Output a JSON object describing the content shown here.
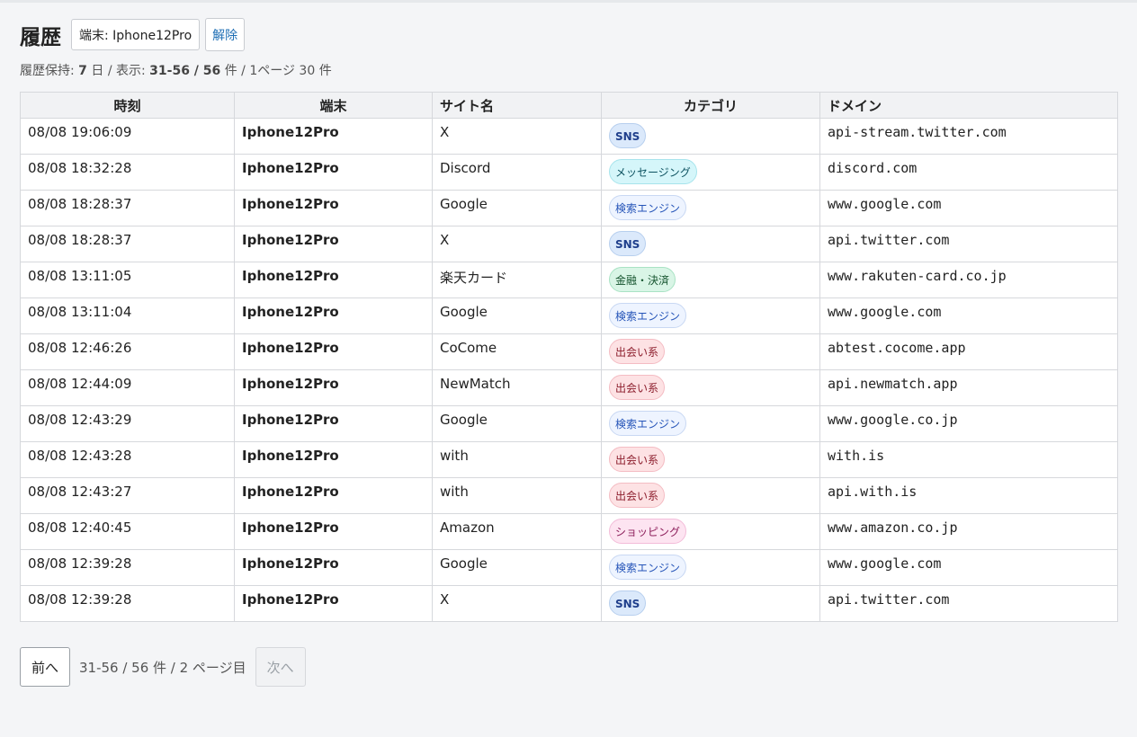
{
  "header": {
    "title": "履歴",
    "filter_label": "端末: Iphone12Pro",
    "clear_label": "解除"
  },
  "summary": {
    "retention_label": "履歴保持: ",
    "retention_value": "7",
    "retention_unit": " 日 / 表示: ",
    "range": "31-56 / 56",
    "range_unit": " 件",
    "per_page": " / 1ページ 30 件"
  },
  "table": {
    "columns": [
      "時刻",
      "端末",
      "サイト名",
      "カテゴリ",
      "ドメイン"
    ],
    "rows": [
      {
        "time": "08/08 19:06:09",
        "device": "Iphone12Pro",
        "site": "X",
        "category": "SNS",
        "category_type": "sns",
        "domain": "api-stream.twitter.com"
      },
      {
        "time": "08/08 18:32:28",
        "device": "Iphone12Pro",
        "site": "Discord",
        "category": "メッセージング",
        "category_type": "msg",
        "domain": "discord.com"
      },
      {
        "time": "08/08 18:28:37",
        "device": "Iphone12Pro",
        "site": "Google",
        "category": "検索エンジン",
        "category_type": "search",
        "domain": "www.google.com"
      },
      {
        "time": "08/08 18:28:37",
        "device": "Iphone12Pro",
        "site": "X",
        "category": "SNS",
        "category_type": "sns",
        "domain": "api.twitter.com"
      },
      {
        "time": "08/08 13:11:05",
        "device": "Iphone12Pro",
        "site": "楽天カード",
        "category": "金融・決済",
        "category_type": "finance",
        "domain": "www.rakuten-card.co.jp"
      },
      {
        "time": "08/08 13:11:04",
        "device": "Iphone12Pro",
        "site": "Google",
        "category": "検索エンジン",
        "category_type": "search",
        "domain": "www.google.com"
      },
      {
        "time": "08/08 12:46:26",
        "device": "Iphone12Pro",
        "site": "CoCome",
        "category": "出会い系",
        "category_type": "dating",
        "domain": "abtest.cocome.app"
      },
      {
        "time": "08/08 12:44:09",
        "device": "Iphone12Pro",
        "site": "NewMatch",
        "category": "出会い系",
        "category_type": "dating",
        "domain": "api.newmatch.app"
      },
      {
        "time": "08/08 12:43:29",
        "device": "Iphone12Pro",
        "site": "Google",
        "category": "検索エンジン",
        "category_type": "search",
        "domain": "www.google.co.jp"
      },
      {
        "time": "08/08 12:43:28",
        "device": "Iphone12Pro",
        "site": "with",
        "category": "出会い系",
        "category_type": "dating",
        "domain": "with.is"
      },
      {
        "time": "08/08 12:43:27",
        "device": "Iphone12Pro",
        "site": "with",
        "category": "出会い系",
        "category_type": "dating",
        "domain": "api.with.is"
      },
      {
        "time": "08/08 12:40:45",
        "device": "Iphone12Pro",
        "site": "Amazon",
        "category": "ショッピング",
        "category_type": "shop",
        "domain": "www.amazon.co.jp"
      },
      {
        "time": "08/08 12:39:28",
        "device": "Iphone12Pro",
        "site": "Google",
        "category": "検索エンジン",
        "category_type": "search",
        "domain": "www.google.com"
      },
      {
        "time": "08/08 12:39:28",
        "device": "Iphone12Pro",
        "site": "X",
        "category": "SNS",
        "category_type": "sns",
        "domain": "api.twitter.com"
      }
    ]
  },
  "pager": {
    "prev_label": "前へ",
    "info": "31-56 / 56 件 / 2 ページ目",
    "next_label": "次へ"
  }
}
